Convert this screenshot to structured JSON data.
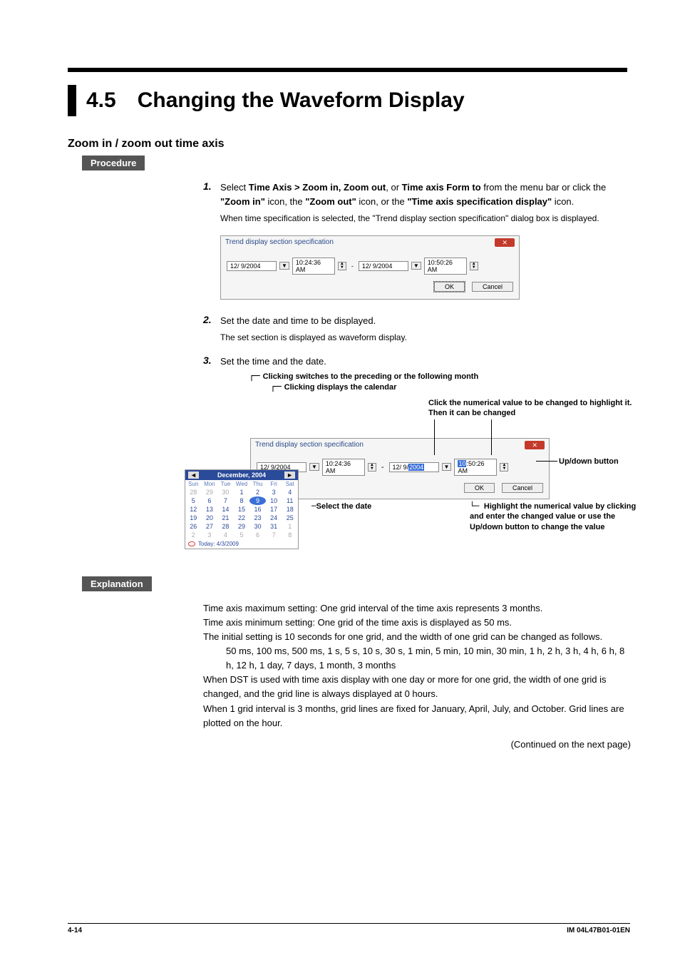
{
  "header": {
    "section_num": "4.5",
    "section_title": "Changing the Waveform Display"
  },
  "heading1": "Zoom in / zoom out time axis",
  "labels": {
    "procedure": "Procedure",
    "explanation": "Explanation"
  },
  "steps": {
    "s1": {
      "num": "1.",
      "pre": "Select ",
      "b1": "Time Axis > Zoom in, Zoom out",
      "mid1": ", or ",
      "b2": "Time axis Form to",
      "mid2": " from the menu bar or click the ",
      "b3": "\"Zoom in\"",
      "mid3": " icon, the ",
      "b4": "\"Zoom out\"",
      "mid4": " icon, or the ",
      "b5": "\"Time axis specification display\"",
      "post": " icon.",
      "sub": "When time specification is selected, the \"Trend display section specification\" dialog box is displayed."
    },
    "s2": {
      "num": "2.",
      "text": "Set the date and time to be displayed.",
      "sub": "The set section is displayed as waveform display."
    },
    "s3": {
      "num": "3.",
      "text": "Set the time and the date."
    }
  },
  "dialog": {
    "title": "Trend display section specification",
    "date1": "12/ 9/2004",
    "time1": "10:24:36 AM",
    "date2": "12/ 9/2004",
    "time2": "10:50:26 AM",
    "ok": "OK",
    "cancel": "Cancel"
  },
  "callouts": {
    "top1": "Clicking switches to the preceding or the following month",
    "top2": "Clicking displays the calendar",
    "r1": "Click the numerical value to be changed to highlight it. Then it can be changed",
    "r2": "Up/down button",
    "r3": "Highlight the numerical value by clicking and enter the changed value or use the Up/down button to change the value",
    "sel": "Select the date"
  },
  "dialog2": {
    "date1": "12/ 9/2004",
    "time1": "10:24:36 AM",
    "date2_pre": "12/ 9/",
    "date2_hl": "2004",
    "time2_pre_hl": "10",
    "time2_rest": ":50:26 AM"
  },
  "calendar": {
    "month": "December, 2004",
    "dow": [
      "Sun",
      "Mon",
      "Tue",
      "Wed",
      "Thu",
      "Fri",
      "Sat"
    ],
    "row1": [
      "28",
      "29",
      "30",
      "1",
      "2",
      "3",
      "4"
    ],
    "row2": [
      "5",
      "6",
      "7",
      "8",
      "9",
      "10",
      "11"
    ],
    "row3": [
      "12",
      "13",
      "14",
      "15",
      "16",
      "17",
      "18"
    ],
    "row4": [
      "19",
      "20",
      "21",
      "22",
      "23",
      "24",
      "25"
    ],
    "row5": [
      "26",
      "27",
      "28",
      "29",
      "30",
      "31",
      "1"
    ],
    "row6": [
      "2",
      "3",
      "4",
      "5",
      "6",
      "7",
      "8"
    ],
    "today_label": "Today: 4/3/2009"
  },
  "explanation": {
    "p1": "Time axis maximum setting: One grid interval of the time axis represents 3 months.",
    "p2": "Time axis minimum setting: One grid of the time axis is displayed as 50 ms.",
    "p3": "The initial setting is 10 seconds for one grid, and the width of one grid can be changed as follows.",
    "p4": "50 ms, 100 ms, 500 ms, 1 s, 5 s, 10 s, 30 s, 1 min, 5 min, 10 min, 30 min, 1 h, 2 h, 3 h, 4 h, 6 h, 8 h, 12 h, 1 day, 7 days, 1 month, 3 months",
    "p5": "When DST is used with time axis display with one day or more for one grid, the width of one grid is changed, and the grid line is always displayed at 0 hours.",
    "p6": "When 1 grid interval is 3 months, grid lines are fixed for January, April, July, and October. Grid lines are plotted on the hour.",
    "continued": "(Continued on the next page)"
  },
  "footer": {
    "page": "4-14",
    "doc": "IM 04L47B01-01EN"
  }
}
